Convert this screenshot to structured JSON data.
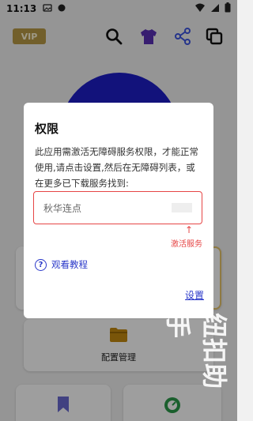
{
  "status_bar": {
    "time": "11:13"
  },
  "top_bar": {
    "vip_label": "VIP",
    "icons": [
      "search-icon",
      "tshirt-icon",
      "share-icon",
      "copy-icon"
    ]
  },
  "background": {
    "config_label": "配置管理",
    "watermark": "纽扣助手"
  },
  "dialog": {
    "title": "权限",
    "message": "此应用需激活无障碍服务权限，才能正常使用,请点击设置,然后在无障碍列表，或在更多已下载服务找到:",
    "service_name": "秋华连点",
    "arrow": "↑",
    "activate_label": "激活服务",
    "tutorial_label": "观看教程",
    "settings_label": "设置"
  },
  "colors": {
    "accent_blue": "#2a38c9",
    "alert_red": "#e64646",
    "vip_gold": "#b89a46",
    "circle_blue": "#1e1ec7"
  }
}
